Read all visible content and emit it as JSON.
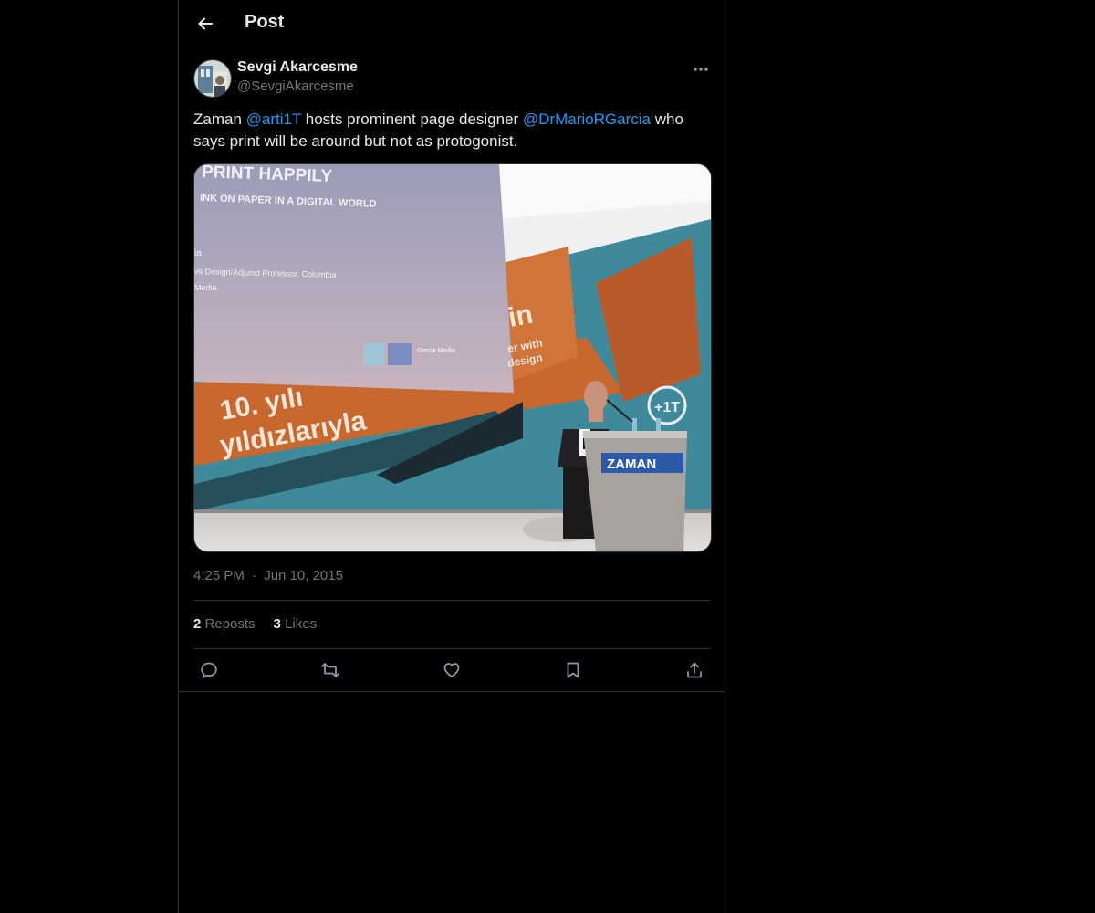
{
  "header": {
    "title": "Post",
    "back_icon": "arrow-left-icon"
  },
  "author": {
    "display_name": "Sevgi Akarcesme",
    "handle": "@SevgiAkarcesme",
    "avatar_icon": "user-avatar"
  },
  "post": {
    "text_parts": [
      {
        "text": "Zaman ",
        "mention": false
      },
      {
        "text": "@arti1T",
        "mention": true
      },
      {
        "text": " hosts prominent page designer ",
        "mention": false
      },
      {
        "text": "@DrMarioRGarcia",
        "mention": true
      },
      {
        "text": " who says print will be around but not as protogonist.",
        "mention": false
      }
    ],
    "image": {
      "screen_title": "PRINT HAPPILY",
      "screen_subtitle": "INK ON PAPER IN A DIGITAL WORLD",
      "screen_line1": "ia",
      "screen_line2": "vs Design/Adjunct Professor, Columbia",
      "screen_line3": "Media",
      "screen_logo_text": "Garcia Media",
      "banner_line1": "10. yılı",
      "banner_line2": "yıldızlarıyla",
      "banner_orange_text1": "in",
      "banner_orange_text2": "er with",
      "banner_orange_text3": "design",
      "badge_text": "+1T",
      "podium_text": "ZAMAN"
    },
    "time": "4:25 PM",
    "separator": "·",
    "date": "Jun 10, 2015"
  },
  "stats": {
    "reposts_count": "2",
    "reposts_label": "Reposts",
    "likes_count": "3",
    "likes_label": "Likes"
  },
  "actions": [
    {
      "icon": "reply-icon"
    },
    {
      "icon": "repost-icon"
    },
    {
      "icon": "like-icon"
    },
    {
      "icon": "bookmark-icon"
    },
    {
      "icon": "share-icon"
    }
  ],
  "colors": {
    "mention": "#1d9bf0",
    "secondary_text": "#71767b",
    "border": "#2f3336",
    "background": "#000000"
  }
}
